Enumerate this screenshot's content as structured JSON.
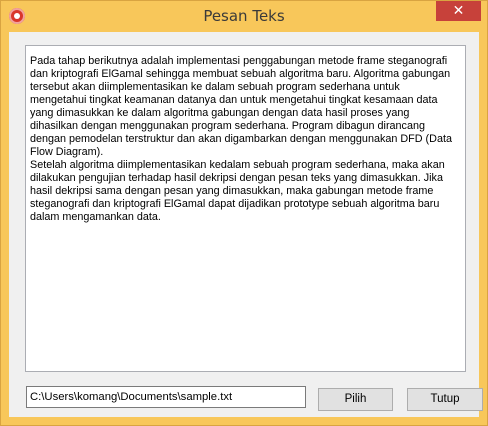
{
  "window": {
    "title": "Pesan Teks",
    "close_label": "✕"
  },
  "message": {
    "text": "Pada tahap berikutnya adalah implementasi penggabungan metode frame steganografi dan kriptografi ElGamal sehingga membuat sebuah algoritma baru. Algoritma gabungan tersebut akan diimplementasikan ke dalam sebuah program sederhana untuk mengetahui tingkat keamanan datanya dan untuk mengetahui tingkat kesamaan data yang dimasukkan ke dalam algoritma gabungan dengan data hasil proses yang dihasilkan dengan menggunakan program sederhana. Program dibagun dirancang dengan pemodelan terstruktur dan akan digambarkan dengan menggunakan DFD (Data Flow Diagram).\nSetelah algoritma diimplementasikan kedalam sebuah program sederhana, maka akan dilakukan pengujian terhadap hasil dekripsi dengan pesan teks yang dimasukkan. Jika hasil dekripsi sama dengan pesan yang dimasukkan, maka gabungan metode frame steganografi dan kriptografi ElGamal dapat dijadikan prototype sebuah algoritma baru dalam mengamankan data."
  },
  "file_path": {
    "value": "C:\\Users\\komang\\Documents\\sample.txt"
  },
  "buttons": {
    "pilih": "Pilih",
    "tutup": "Tutup"
  },
  "colors": {
    "titlebar": "#f8c75a",
    "close_button": "#c7413a",
    "client_background": "#f0f0f0"
  }
}
